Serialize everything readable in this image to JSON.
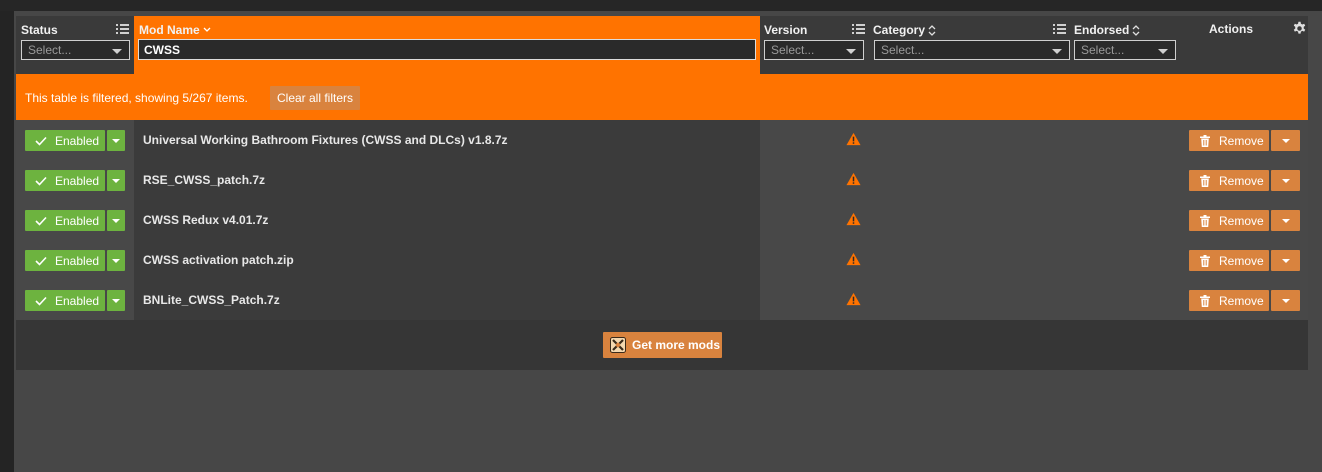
{
  "table": {
    "columns": {
      "status": {
        "title": "Status",
        "filter_placeholder": "Select..."
      },
      "mod_name": {
        "title": "Mod Name",
        "sort_icon": "chevron-down-icon",
        "filter_value": "CWSS"
      },
      "version": {
        "title": "Version",
        "filter_placeholder": "Select..."
      },
      "category": {
        "title": "Category",
        "sort_icon": "sort-updown-icon",
        "filter_placeholder": "Select..."
      },
      "endorsed": {
        "title": "Endorsed",
        "sort_icon": "sort-updown-icon",
        "filter_placeholder": "Select..."
      },
      "actions": {
        "title": "Actions",
        "settings_icon": "gear-icon"
      }
    },
    "banner": {
      "text": "This table is filtered, showing 5/267 items.",
      "clear_label": "Clear all filters"
    },
    "rows": [
      {
        "status": "Enabled",
        "name": "Universal Working Bathroom Fixtures (CWSS and DLCs) v1.8.7z",
        "endorsed_icon": "warning-icon",
        "action": "Remove"
      },
      {
        "status": "Enabled",
        "name": "RSE_CWSS_patch.7z",
        "endorsed_icon": "warning-icon",
        "action": "Remove"
      },
      {
        "status": "Enabled",
        "name": "CWSS Redux v4.01.7z",
        "endorsed_icon": "warning-icon",
        "action": "Remove"
      },
      {
        "status": "Enabled",
        "name": "CWSS activation patch.zip",
        "endorsed_icon": "warning-icon",
        "action": "Remove"
      },
      {
        "status": "Enabled",
        "name": "BNLite_CWSS_Patch.7z",
        "endorsed_icon": "warning-icon",
        "action": "Remove"
      }
    ],
    "footer": {
      "get_more_label": "Get more mods",
      "icon": "nexus-logo-icon"
    }
  },
  "colors": {
    "accent": "#ff7300",
    "enabled": "#6db33f",
    "action": "#d9833e",
    "panel": "#474747"
  }
}
